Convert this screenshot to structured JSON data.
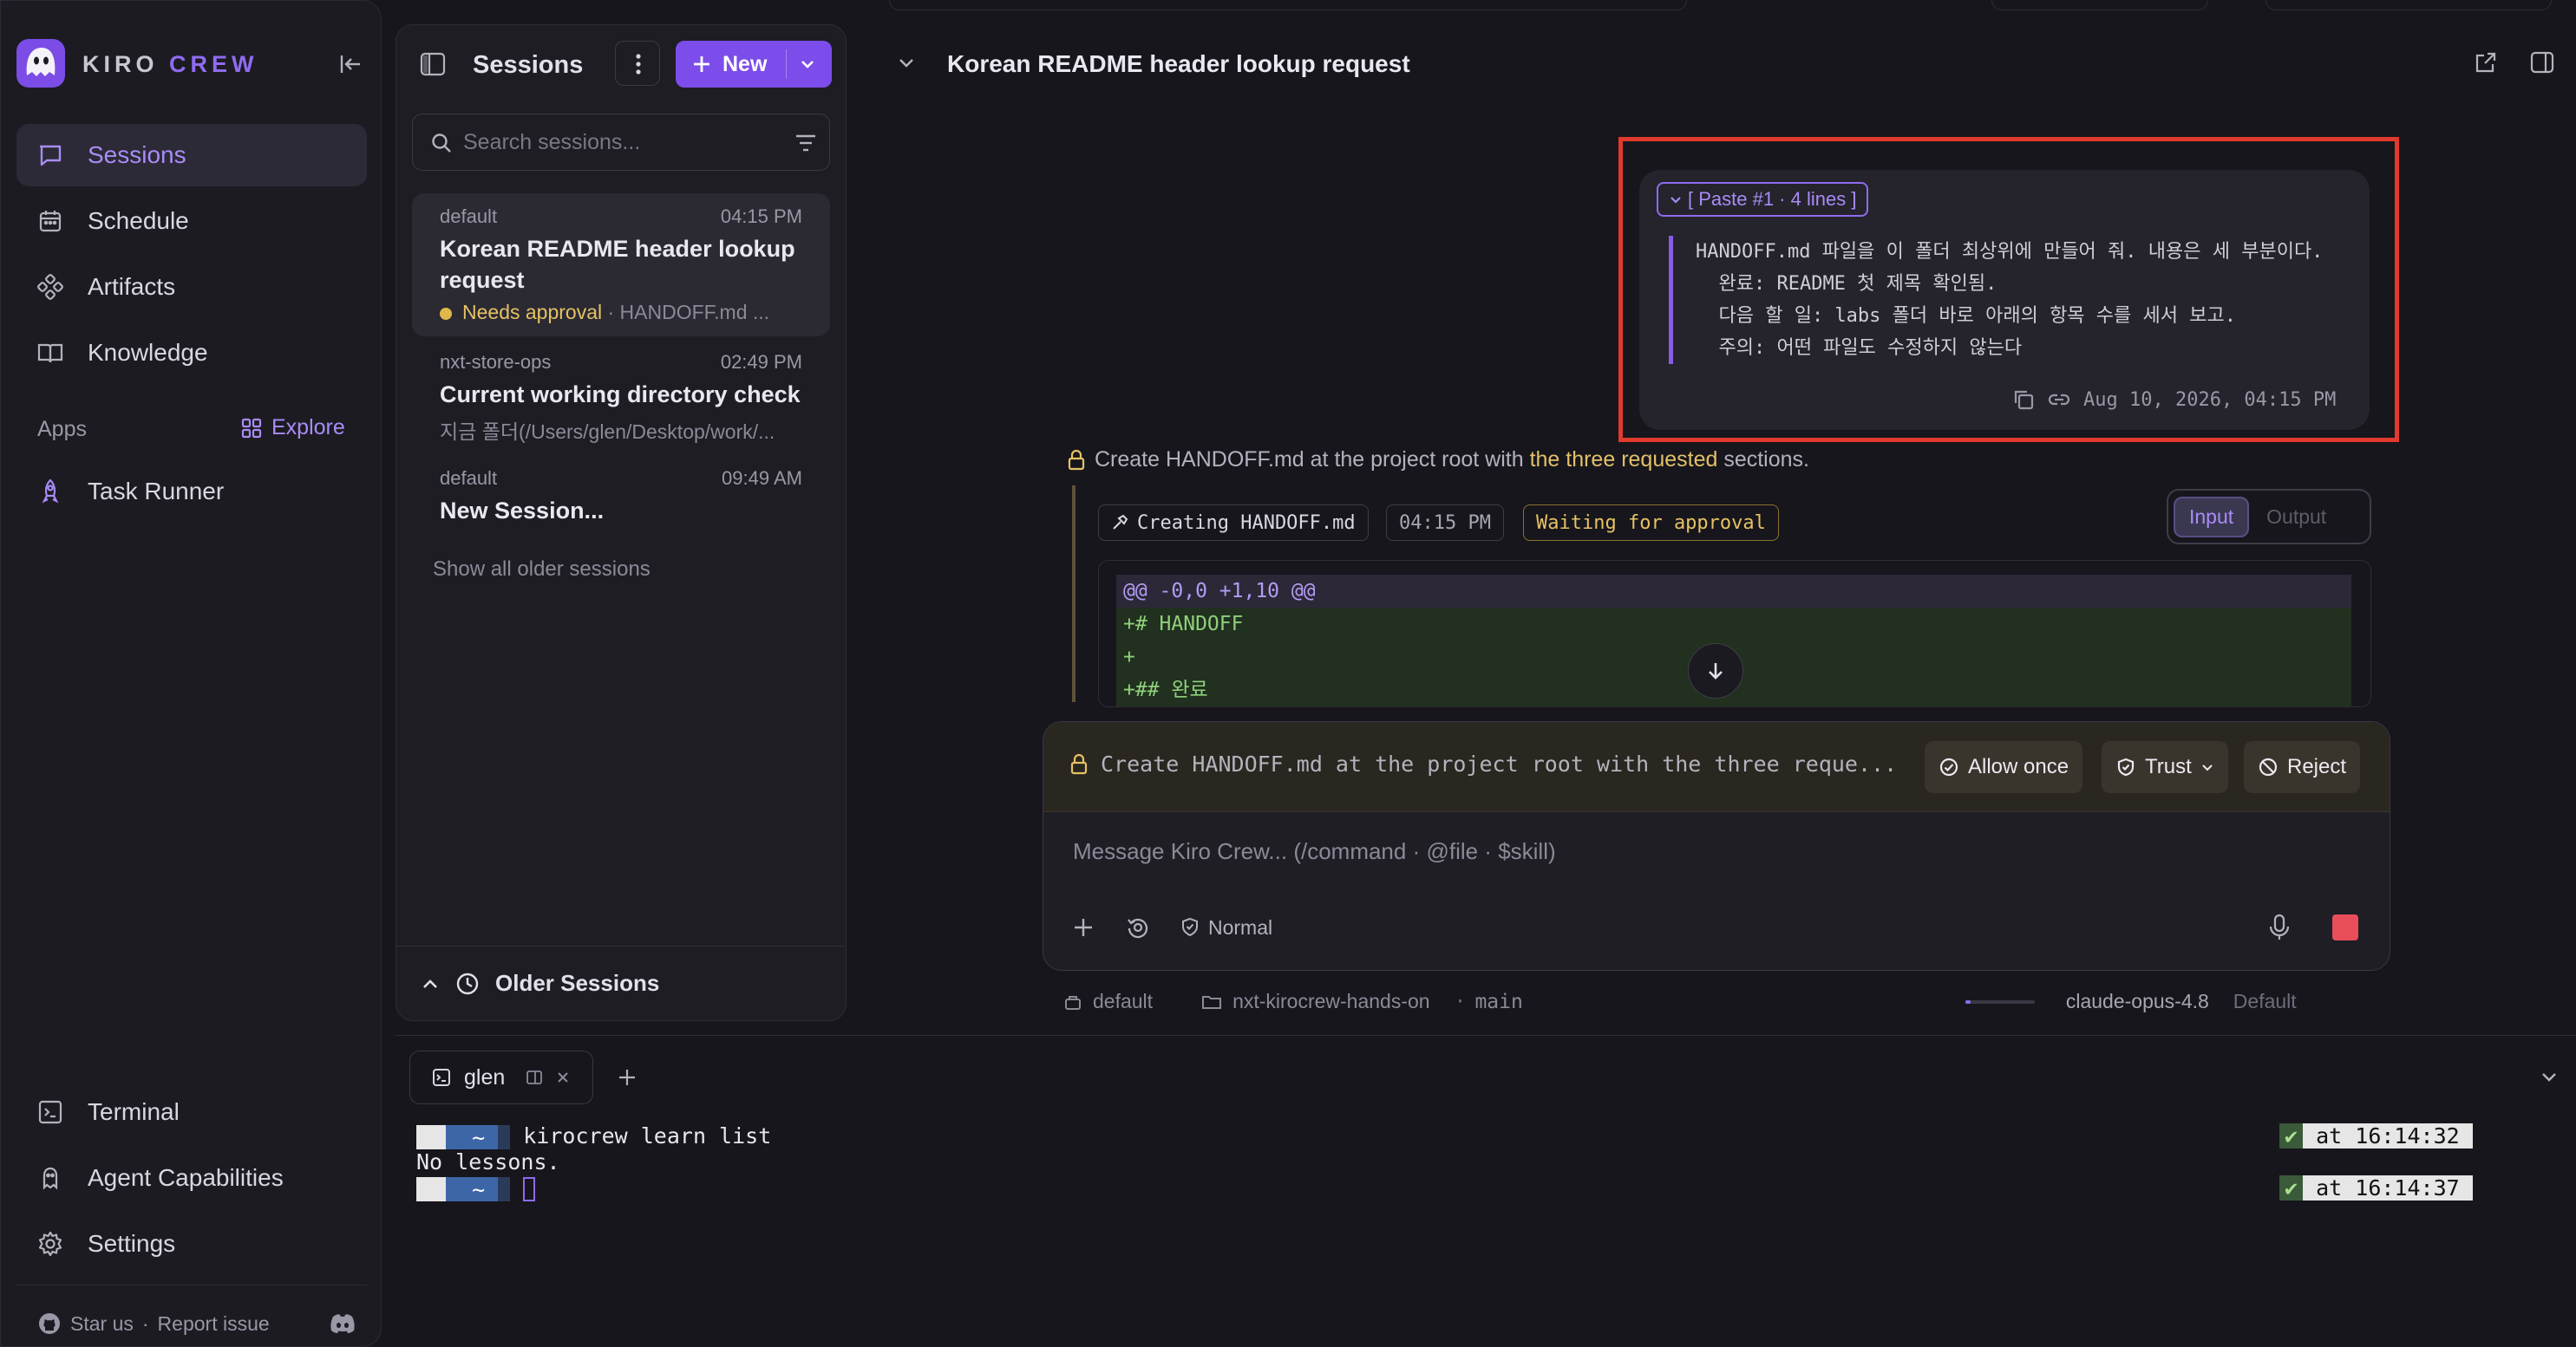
{
  "brand": {
    "name_a": "KIRO",
    "name_b": "CREW"
  },
  "nav": {
    "items": [
      {
        "label": "Sessions"
      },
      {
        "label": "Schedule"
      },
      {
        "label": "Artifacts"
      },
      {
        "label": "Knowledge"
      }
    ],
    "apps_heading": "Apps",
    "explore_label": "Explore",
    "apps": [
      {
        "label": "Task Runner"
      }
    ],
    "bottom": [
      {
        "label": "Terminal"
      },
      {
        "label": "Agent Capabilities"
      },
      {
        "label": "Settings"
      }
    ],
    "star_label": "Star us",
    "separator": "·",
    "report_label": "Report issue"
  },
  "sessions_panel": {
    "title": "Sessions",
    "new_label": "New",
    "search_placeholder": "Search sessions...",
    "list": [
      {
        "workspace": "default",
        "time": "04:15 PM",
        "title": "Korean README header lookup request",
        "status": "Needs approval",
        "sub": " · HANDOFF.md ..."
      },
      {
        "workspace": "nxt-store-ops",
        "time": "02:49 PM",
        "title": "Current working directory check",
        "sub": "지금 폴더(/Users/glen/Desktop/work/..."
      },
      {
        "workspace": "default",
        "time": "09:49 AM",
        "title": "New Session..."
      }
    ],
    "show_older": "Show all older sessions",
    "older_label": "Older Sessions"
  },
  "chat": {
    "title": "Korean README header lookup request",
    "paste": {
      "chip": "[ Paste #1 · 4 lines ]",
      "lines": [
        "HANDOFF.md 파일을 이 폴더 최상위에 만들어 줘. 내용은 세 부분이다.",
        "  완료: README 첫 제목 확인됨.",
        "  다음 할 일: labs 폴더 바로 아래의 항목 수를 세서 보고.",
        "  주의: 어떤 파일도 수정하지 않는다"
      ],
      "timestamp": "Aug 10, 2026, 04:15 PM"
    },
    "approval_pre": "Create HANDOFF.md at the project root with ",
    "approval_hl": "the three requested",
    "approval_post": " sections.",
    "tool": {
      "action": "Creating HANDOFF.md",
      "time": "04:15 PM",
      "status": "Waiting for approval",
      "input_label": "Input",
      "output_label": "Output"
    },
    "diff": [
      {
        "kind": "hunk",
        "text": "@@ -0,0 +1,10 @@"
      },
      {
        "kind": "add",
        "text": "+# HANDOFF"
      },
      {
        "kind": "add",
        "text": "+"
      },
      {
        "kind": "add",
        "text": "+## 완료"
      }
    ]
  },
  "composer": {
    "permission_text": "Create HANDOFF.md at the project root with the three reque...",
    "allow_once": "Allow once",
    "trust": "Trust",
    "reject": "Reject",
    "placeholder": "Message Kiro Crew... (/command · @file · $skill)",
    "mode": "Normal"
  },
  "status_bar": {
    "workspace": "default",
    "repo": "nxt-kirocrew-hands-on",
    "branch": "main",
    "model": "claude-opus-4.8",
    "profile": "Default"
  },
  "terminal": {
    "tab_label": "glen",
    "prompt_glyphs": "  ~ ",
    "lines": [
      {
        "cmd": "kirocrew learn list",
        "right": " at 16:14:32 "
      },
      {
        "output": "No lessons."
      },
      {
        "cmd": "",
        "right": " at 16:14:37 "
      }
    ],
    "check": "✔"
  },
  "colors": {
    "accent": "#8f6cf0",
    "primary_button": "#7c4dea",
    "warning": "#e6c264",
    "highlight_box": "#e23a2e",
    "stop": "#e84e5a"
  }
}
